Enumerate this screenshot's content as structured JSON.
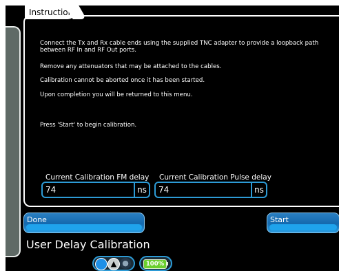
{
  "tab": {
    "label": "Instructions"
  },
  "instructions": [
    "Connect the Tx and Rx cable ends using the supplied TNC adapter to provide a loopback path between RF In and RF Out ports.",
    "Remove any attenuators that may be attached to the cables.",
    "Calibration cannot be aborted once it has been started.",
    "Upon completion you will be returned to this menu.",
    "Press 'Start' to begin calibration."
  ],
  "fields": {
    "fm": {
      "label": "Current Calibration FM delay",
      "value": "74",
      "unit": "ns"
    },
    "pulse": {
      "label": "Current Calibration Pulse delay",
      "value": "74",
      "unit": "ns"
    }
  },
  "buttons": {
    "done": "Done",
    "start": "Start"
  },
  "title": "User Delay Calibration",
  "status": {
    "battery": "100%",
    "icons": [
      "blue-circle-icon",
      "info-icon",
      "info-dim-icon"
    ]
  },
  "colors": {
    "accent": "#2d9bd6",
    "battery": "#6bcf2e"
  }
}
